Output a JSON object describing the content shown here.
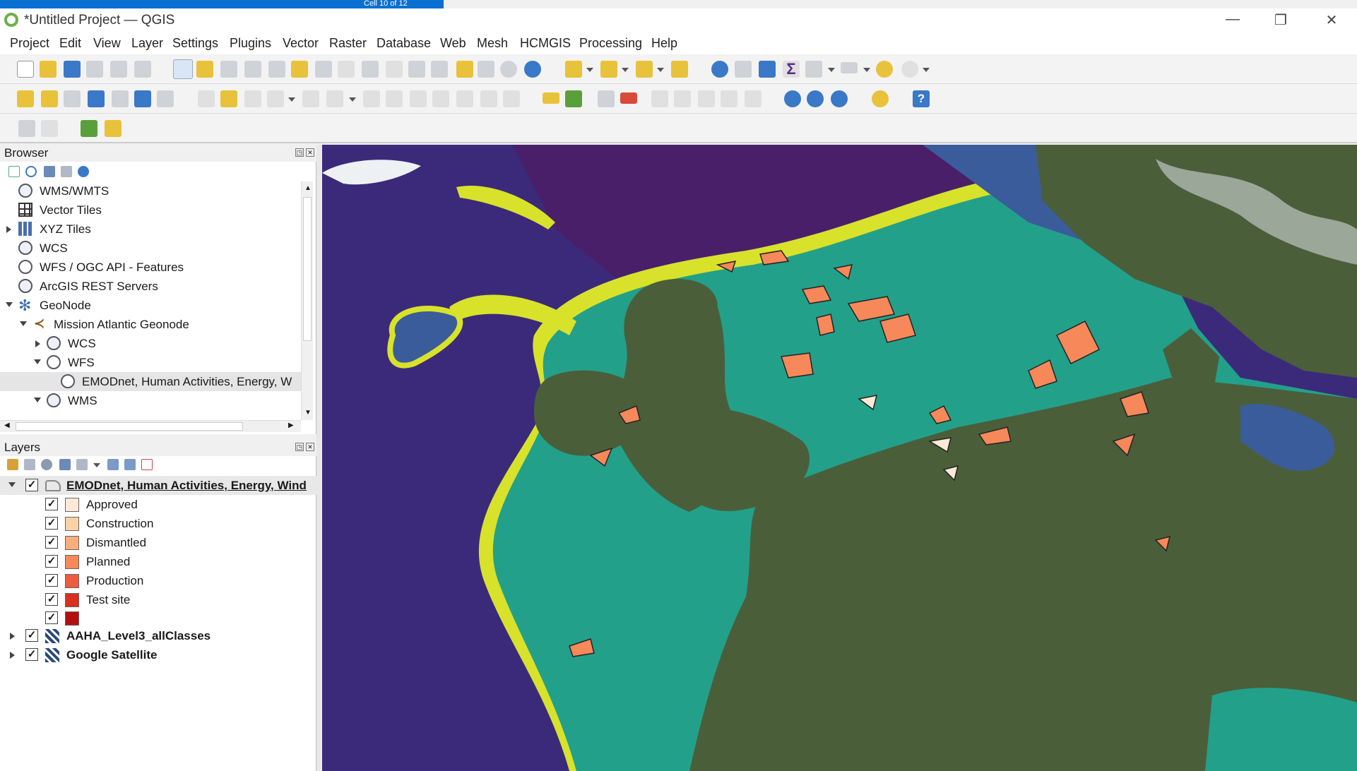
{
  "taskbar_hint": "Cell 10 of 12",
  "window": {
    "title": "*Untitled Project — QGIS",
    "minimize": "—",
    "maximize": "❐",
    "close": "✕"
  },
  "menu": [
    "Project",
    "Edit",
    "View",
    "Layer",
    "Settings",
    "Plugins",
    "Vector",
    "Raster",
    "Database",
    "Web",
    "Mesh",
    "HCMGIS",
    "Processing",
    "Help"
  ],
  "browser": {
    "title": "Browser",
    "items": [
      {
        "label": "WMS/WMTS",
        "icon": "globe-icon"
      },
      {
        "label": "Vector Tiles",
        "icon": "grid-icon"
      },
      {
        "label": "XYZ Tiles",
        "icon": "xyz-tiles-icon"
      },
      {
        "label": "WCS",
        "icon": "globe-icon"
      },
      {
        "label": "WFS / OGC API - Features",
        "icon": "wfs-globe-icon"
      },
      {
        "label": "ArcGIS REST Servers",
        "icon": "globe-icon"
      },
      {
        "label": "GeoNode",
        "icon": "geonode-icon"
      },
      {
        "label": "Mission Atlantic Geonode",
        "icon": "connection-icon"
      },
      {
        "label": "WCS",
        "icon": "globe-icon"
      },
      {
        "label": "WFS",
        "icon": "wfs-globe-icon"
      },
      {
        "label": "EMODnet, Human Activities, Energy, W",
        "icon": "wfs-globe-icon"
      },
      {
        "label": "WMS",
        "icon": "globe-icon"
      }
    ]
  },
  "layers": {
    "title": "Layers",
    "group_layer": "EMODnet, Human Activities, Energy, Wind",
    "categories": [
      {
        "label": "Approved",
        "color": "#fde9d6"
      },
      {
        "label": "Construction",
        "color": "#fbd2a5"
      },
      {
        "label": "Dismantled",
        "color": "#f9ad7a"
      },
      {
        "label": "Planned",
        "color": "#f6885a"
      },
      {
        "label": "Production",
        "color": "#ee5b3e"
      },
      {
        "label": "Test site",
        "color": "#d9301f"
      },
      {
        "label": "",
        "color": "#b30f0f"
      }
    ],
    "raster_layers": [
      "AAHA_Level3_allClasses",
      "Google Satellite"
    ]
  },
  "colors": {
    "deep_ocean": "#3b2a7a",
    "shelf_teal": "#23a08a",
    "mid_blue": "#3b5c9a",
    "yellow_class": "#d8e22a",
    "land": "#4b5e3a",
    "wind_farm": "#f6885a"
  }
}
